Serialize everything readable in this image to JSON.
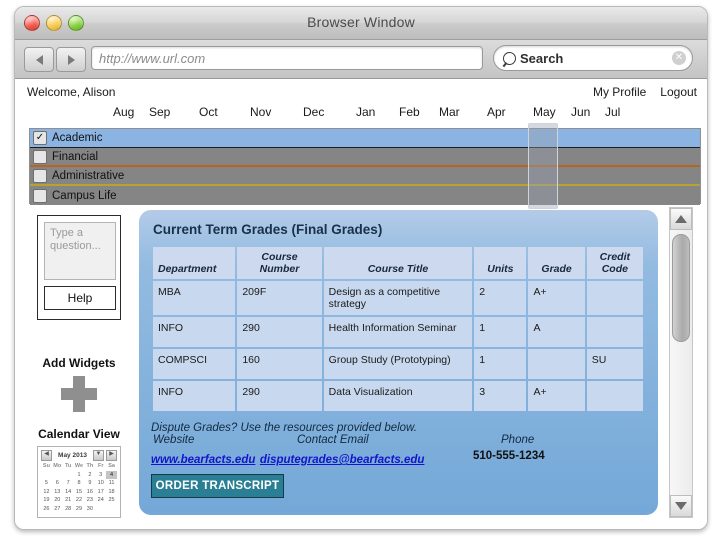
{
  "window": {
    "title": "Browser Window",
    "traffic_lights": [
      "close-red",
      "minimize-yellow",
      "zoom-green"
    ]
  },
  "toolbar": {
    "back_icon": "back-arrow-icon",
    "forward_icon": "forward-arrow-icon",
    "url_value": "http://www.url.com",
    "url_placeholder": "http://www.url.com",
    "search_placeholder": "Search",
    "search_value": "Search",
    "search_icon": "magnifier-icon",
    "clear_icon": "clear-x-icon",
    "clear_label": "✕"
  },
  "header": {
    "welcome": "Welcome, Alison",
    "my_profile": "My Profile",
    "logout": "Logout"
  },
  "timeline": {
    "months": [
      "Aug",
      "Sep",
      "Oct",
      "Nov",
      "Dec",
      "Jan",
      "Feb",
      "Mar",
      "Apr",
      "May",
      "Jun",
      "Jul"
    ],
    "highlighted_month": "May",
    "categories": [
      {
        "label": "Academic",
        "checked": true,
        "check_glyph": "✓",
        "color": "#8cb4e2"
      },
      {
        "label": "Financial",
        "checked": false,
        "check_glyph": "",
        "color": "#858585"
      },
      {
        "label": "Administrative",
        "checked": false,
        "check_glyph": "",
        "color": "#858585"
      },
      {
        "label": "Campus Life",
        "checked": false,
        "check_glyph": "",
        "color": "#858585"
      }
    ]
  },
  "sidebar": {
    "question_placeholder": "Type a question...",
    "question_value": "Type a question...",
    "help_label": "Help",
    "add_widgets_label": "Add Widgets",
    "add_widget_icon": "plus-icon",
    "calendar_view_label": "Calendar View",
    "calendar": {
      "month_label": "May 2013",
      "prev_icon": "chevron-left-icon",
      "next_icon": "chevron-down-icon",
      "forward_icon": "chevron-right-icon",
      "dow": [
        "Su",
        "Mo",
        "Tu",
        "We",
        "Th",
        "Fr",
        "Sa"
      ],
      "weeks": [
        [
          "",
          "",
          "",
          "1",
          "2",
          "3",
          "4"
        ],
        [
          "5",
          "6",
          "7",
          "8",
          "9",
          "10",
          "11"
        ],
        [
          "12",
          "13",
          "14",
          "15",
          "16",
          "17",
          "18"
        ],
        [
          "19",
          "20",
          "21",
          "22",
          "23",
          "24",
          "25"
        ],
        [
          "26",
          "27",
          "28",
          "29",
          "30",
          "",
          ""
        ]
      ],
      "selected_day": "4"
    }
  },
  "main": {
    "panel_title": "Current Term Grades (Final Grades)",
    "table": {
      "columns": [
        "Department",
        "Course Number",
        "Course Title",
        "Units",
        "Grade",
        "Credit Code"
      ],
      "rows": [
        {
          "department": "MBA",
          "number": "209F",
          "title": "Design as a competitive strategy",
          "units": "2",
          "grade": "A+",
          "credit": ""
        },
        {
          "department": "INFO",
          "number": "290",
          "title": "Health Information Seminar",
          "units": "1",
          "grade": "A",
          "credit": ""
        },
        {
          "department": "COMPSCI",
          "number": "160",
          "title": "Group Study (Prototyping)",
          "units": "1",
          "grade": "",
          "credit": "SU"
        },
        {
          "department": "INFO",
          "number": "290",
          "title": "Data Visualization",
          "units": "3",
          "grade": "A+",
          "credit": ""
        }
      ]
    },
    "dispute_text": "Dispute Grades? Use the resources provided below.",
    "resources": {
      "website_label": "Website",
      "website_value": "www.bearfacts.edu",
      "email_label": "Contact Email",
      "email_value": "disputegrades@bearfacts.edu",
      "phone_label": "Phone",
      "phone_value": "510-555-1234"
    },
    "order_transcript_label": "ORDER TRANSCRIPT"
  },
  "scrollbar": {
    "up_icon": "scroll-up-arrow-icon",
    "down_icon": "scroll-down-arrow-icon"
  },
  "colors": {
    "panel_blue": "#93bbe0",
    "academic_blue": "#8cb4e2",
    "category_gray": "#858585",
    "administrative_accent": "#b4661f",
    "campuslife_accent": "#b5a433",
    "link_blue": "#1414cc",
    "transcript_teal": "#2b7f95"
  }
}
